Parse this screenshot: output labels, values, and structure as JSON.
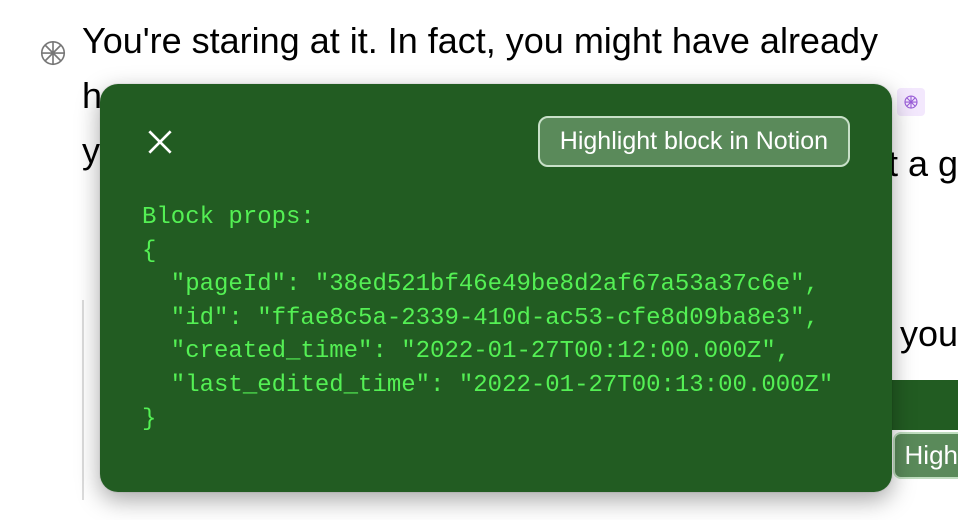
{
  "background": {
    "line1": "You're staring at it. In fact, you might have already",
    "line2": "h",
    "line3": "y",
    "right_fragment_1": "t a g",
    "right_fragment_2": "you",
    "highlight_fragment": "High"
  },
  "popup": {
    "highlight_button": "Highlight block in Notion",
    "code_title": "Block props:",
    "json": {
      "pageId": "38ed521bf46e49be8d2af67a53a37c6e",
      "id": "ffae8c5a-2339-410d-ac53-cfe8d09ba8e3",
      "created_time": "2022-01-27T00:12:00.000Z",
      "last_edited_time": "2022-01-27T00:13:00.000Z"
    }
  }
}
